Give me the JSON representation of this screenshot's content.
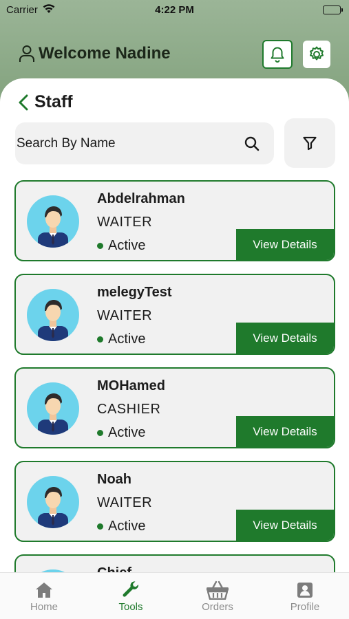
{
  "status_bar": {
    "carrier": "Carrier",
    "time": "4:22 PM"
  },
  "header": {
    "welcome": "Welcome Nadine"
  },
  "page": {
    "title": "Staff"
  },
  "search": {
    "placeholder": "Search By Name"
  },
  "staff": [
    {
      "name": "Abdelrahman",
      "role": "WAITER",
      "status": "Active",
      "action": "View Details"
    },
    {
      "name": "melegyTest",
      "role": "WAITER",
      "status": "Active",
      "action": "View Details"
    },
    {
      "name": "MOHamed",
      "role": "CASHIER",
      "status": "Active",
      "action": "View Details"
    },
    {
      "name": "Noah",
      "role": "WAITER",
      "status": "Active",
      "action": "View Details"
    },
    {
      "name": "Chief",
      "role": "",
      "status": "",
      "action": ""
    }
  ],
  "tabs": [
    {
      "label": "Home",
      "icon": "home-icon"
    },
    {
      "label": "Tools",
      "icon": "wrench-icon",
      "active": true
    },
    {
      "label": "Orders",
      "icon": "basket-icon"
    },
    {
      "label": "Profile",
      "icon": "profile-icon"
    }
  ],
  "colors": {
    "accent": "#1f7a2c",
    "header_bg": "#8aa886",
    "card_bg": "#f1f1f1"
  }
}
